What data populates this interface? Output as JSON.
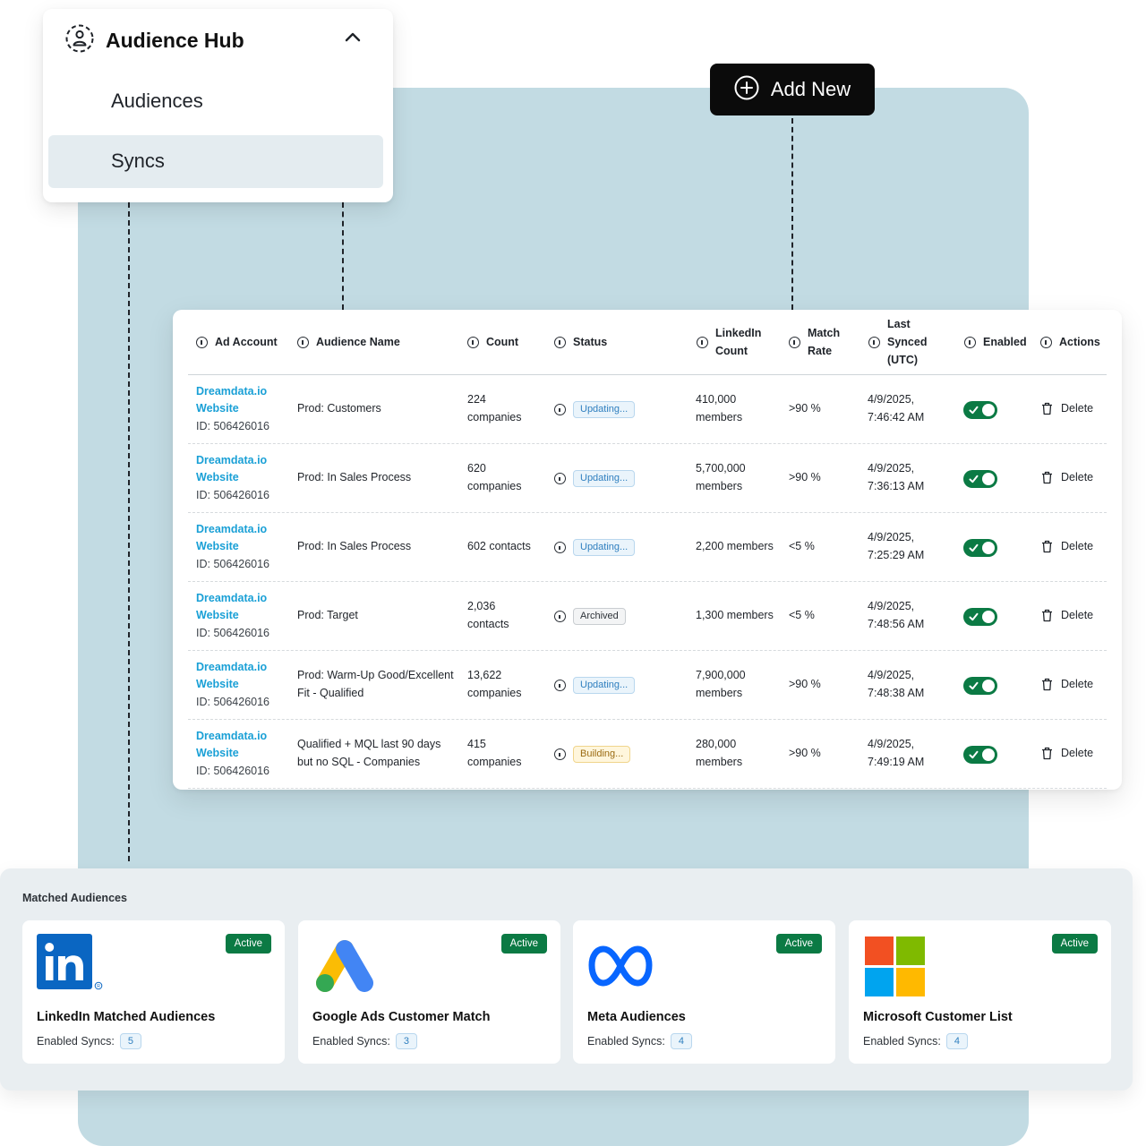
{
  "menu": {
    "title": "Audience Hub",
    "items": [
      {
        "label": "Audiences",
        "selected": false
      },
      {
        "label": "Syncs",
        "selected": true
      }
    ]
  },
  "add_new": {
    "label": "Add New"
  },
  "table": {
    "columns": [
      {
        "key": "ad_account",
        "lines": [
          "Ad Account"
        ]
      },
      {
        "key": "audience_name",
        "lines": [
          "Audience Name"
        ]
      },
      {
        "key": "count",
        "lines": [
          "Count"
        ]
      },
      {
        "key": "status",
        "lines": [
          "Status"
        ]
      },
      {
        "key": "linkedin_count",
        "lines": [
          "LinkedIn",
          "Count"
        ]
      },
      {
        "key": "match_rate",
        "lines": [
          "Match",
          "Rate"
        ]
      },
      {
        "key": "last_synced",
        "lines": [
          "Last",
          "Synced",
          "(UTC)"
        ]
      },
      {
        "key": "enabled",
        "lines": [
          "Enabled"
        ]
      },
      {
        "key": "actions",
        "lines": [
          "Actions"
        ]
      }
    ],
    "rows": [
      {
        "account": [
          "Dreamdata.io",
          "Website"
        ],
        "account_id": "ID: 506426016",
        "audience": [
          "Prod: Customers"
        ],
        "count": [
          "224",
          "companies"
        ],
        "status": "Updating...",
        "status_type": "updating",
        "linkedin": [
          "410,000",
          "members"
        ],
        "match": ">90 %",
        "synced": [
          "4/9/2025,",
          "7:46:42 AM"
        ],
        "enabled": true,
        "action": "Delete"
      },
      {
        "account": [
          "Dreamdata.io",
          "Website"
        ],
        "account_id": "ID: 506426016",
        "audience": [
          "Prod: In Sales Process"
        ],
        "count": [
          "620",
          "companies"
        ],
        "status": "Updating...",
        "status_type": "updating",
        "linkedin": [
          "5,700,000",
          "members"
        ],
        "match": ">90 %",
        "synced": [
          "4/9/2025,",
          "7:36:13 AM"
        ],
        "enabled": true,
        "action": "Delete"
      },
      {
        "account": [
          "Dreamdata.io",
          "Website"
        ],
        "account_id": "ID: 506426016",
        "audience": [
          "Prod: In Sales Process"
        ],
        "count": [
          "602 contacts"
        ],
        "status": "Updating...",
        "status_type": "updating",
        "linkedin": [
          "2,200 members"
        ],
        "match": "<5 %",
        "synced": [
          "4/9/2025,",
          "7:25:29 AM"
        ],
        "enabled": true,
        "action": "Delete"
      },
      {
        "account": [
          "Dreamdata.io",
          "Website"
        ],
        "account_id": "ID: 506426016",
        "audience": [
          "Prod: Target"
        ],
        "count": [
          "2,036",
          "contacts"
        ],
        "status": "Archived",
        "status_type": "archived",
        "linkedin": [
          "1,300 members"
        ],
        "match": "<5 %",
        "synced": [
          "4/9/2025,",
          "7:48:56 AM"
        ],
        "enabled": true,
        "action": "Delete"
      },
      {
        "account": [
          "Dreamdata.io",
          "Website"
        ],
        "account_id": "ID: 506426016",
        "audience": [
          "Prod: Warm-Up Good/Excellent",
          "Fit - Qualified"
        ],
        "count": [
          "13,622",
          "companies"
        ],
        "status": "Updating...",
        "status_type": "updating",
        "linkedin": [
          "7,900,000",
          "members"
        ],
        "match": ">90 %",
        "synced": [
          "4/9/2025,",
          "7:48:38 AM"
        ],
        "enabled": true,
        "action": "Delete"
      },
      {
        "account": [
          "Dreamdata.io",
          "Website"
        ],
        "account_id": "ID: 506426016",
        "audience": [
          "Qualified + MQL last 90 days",
          "but no SQL - Companies"
        ],
        "count": [
          "415",
          "companies"
        ],
        "status": "Building...",
        "status_type": "building",
        "linkedin": [
          "280,000",
          "members"
        ],
        "match": ">90 %",
        "synced": [
          "4/9/2025,",
          "7:49:19 AM"
        ],
        "enabled": true,
        "action": "Delete"
      }
    ]
  },
  "matched": {
    "title": "Matched Audiences",
    "sync_label": "Enabled Syncs:",
    "cards": [
      {
        "name": "LinkedIn Matched Audiences",
        "status": "Active",
        "syncs": "5",
        "icon": "linkedin-logo-icon"
      },
      {
        "name": "Google Ads Customer Match",
        "status": "Active",
        "syncs": "3",
        "icon": "google-ads-logo-icon"
      },
      {
        "name": "Meta Audiences",
        "status": "Active",
        "syncs": "4",
        "icon": "meta-logo-icon"
      },
      {
        "name": "Microsoft Customer List",
        "status": "Active",
        "syncs": "4",
        "icon": "microsoft-logo-icon"
      }
    ]
  },
  "colors": {
    "accent_link": "#1aa0d6",
    "toggle_on": "#0b7a44",
    "active_badge": "#0b7a44",
    "background_panel": "#c2dbe3",
    "selected_menu": "#e4ecf0"
  }
}
